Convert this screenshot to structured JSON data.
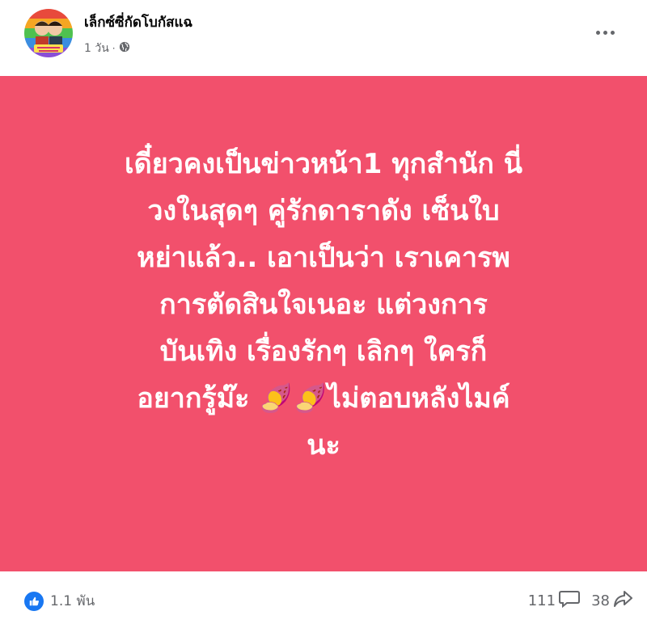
{
  "post": {
    "page_name": "เล็กซ์ซี่กัดโบกัสแฉ",
    "time": "1 วัน",
    "separator": "·",
    "lines": [
      "เดี๋ยวคงเป็นข่าวหน้า1 ทุกสำนัก นี่",
      "วงในสุดๆ คู่รักดาราดัง เซ็นใบ",
      "หย่าแล้ว.. เอาเป็นว่า เราเคารพ",
      "การตัดสินใจเนอะ แต่วงการ",
      "บันเทิง เรื่องรักๆ เลิกๆ ใครก็",
      "อยากรู้ม๊ะ 🍠🍠ไม่ตอบหลังไมค์",
      "นะ"
    ],
    "background_color": "#f2506c"
  },
  "footer": {
    "reactions_count": "1.1 พัน",
    "comments_count": "111",
    "shares_count": "38"
  },
  "icons": {
    "privacy": "globe-icon",
    "more": "more-options-icon",
    "like": "like-icon",
    "comment": "comment-icon",
    "share": "share-icon"
  }
}
